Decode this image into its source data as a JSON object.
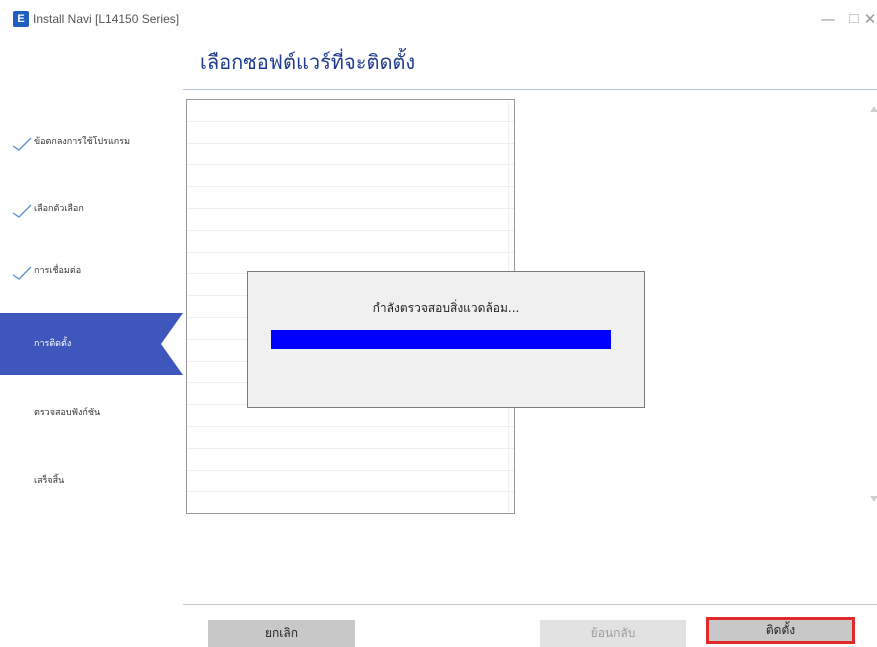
{
  "window": {
    "icon_letter": "E",
    "title": "Install Navi [L14150 Series]",
    "controls": {
      "minimize": "—",
      "close": "✕"
    }
  },
  "page": {
    "title": "เลือกซอฟต์แวร์ที่จะติดตั้ง"
  },
  "sidebar": {
    "steps": [
      {
        "label": "ข้อตกลงการใช้โปรแกรม",
        "state": "done"
      },
      {
        "label": "เลือกตัวเลือก",
        "state": "done"
      },
      {
        "label": "การเชื่อมต่อ",
        "state": "done"
      },
      {
        "label": "การติดตั้ง",
        "state": "active"
      },
      {
        "label": "ตรวจสอบฟังก์ชัน",
        "state": "pending"
      },
      {
        "label": "เสร็จสิ้น",
        "state": "pending"
      }
    ]
  },
  "dialog": {
    "message": "กำลังตรวจสอบสิ่งแวดล้อม...",
    "progress_fraction": 1.0,
    "progress_color": "#0000ff"
  },
  "buttons": {
    "cancel": "ยกเลิก",
    "back": "ย้อนกลับ",
    "install": "ติดตั้ง"
  },
  "colors": {
    "active_step": "#3f56bd",
    "title_text": "#1d3a8f",
    "highlight_border": "#e02a2a"
  }
}
